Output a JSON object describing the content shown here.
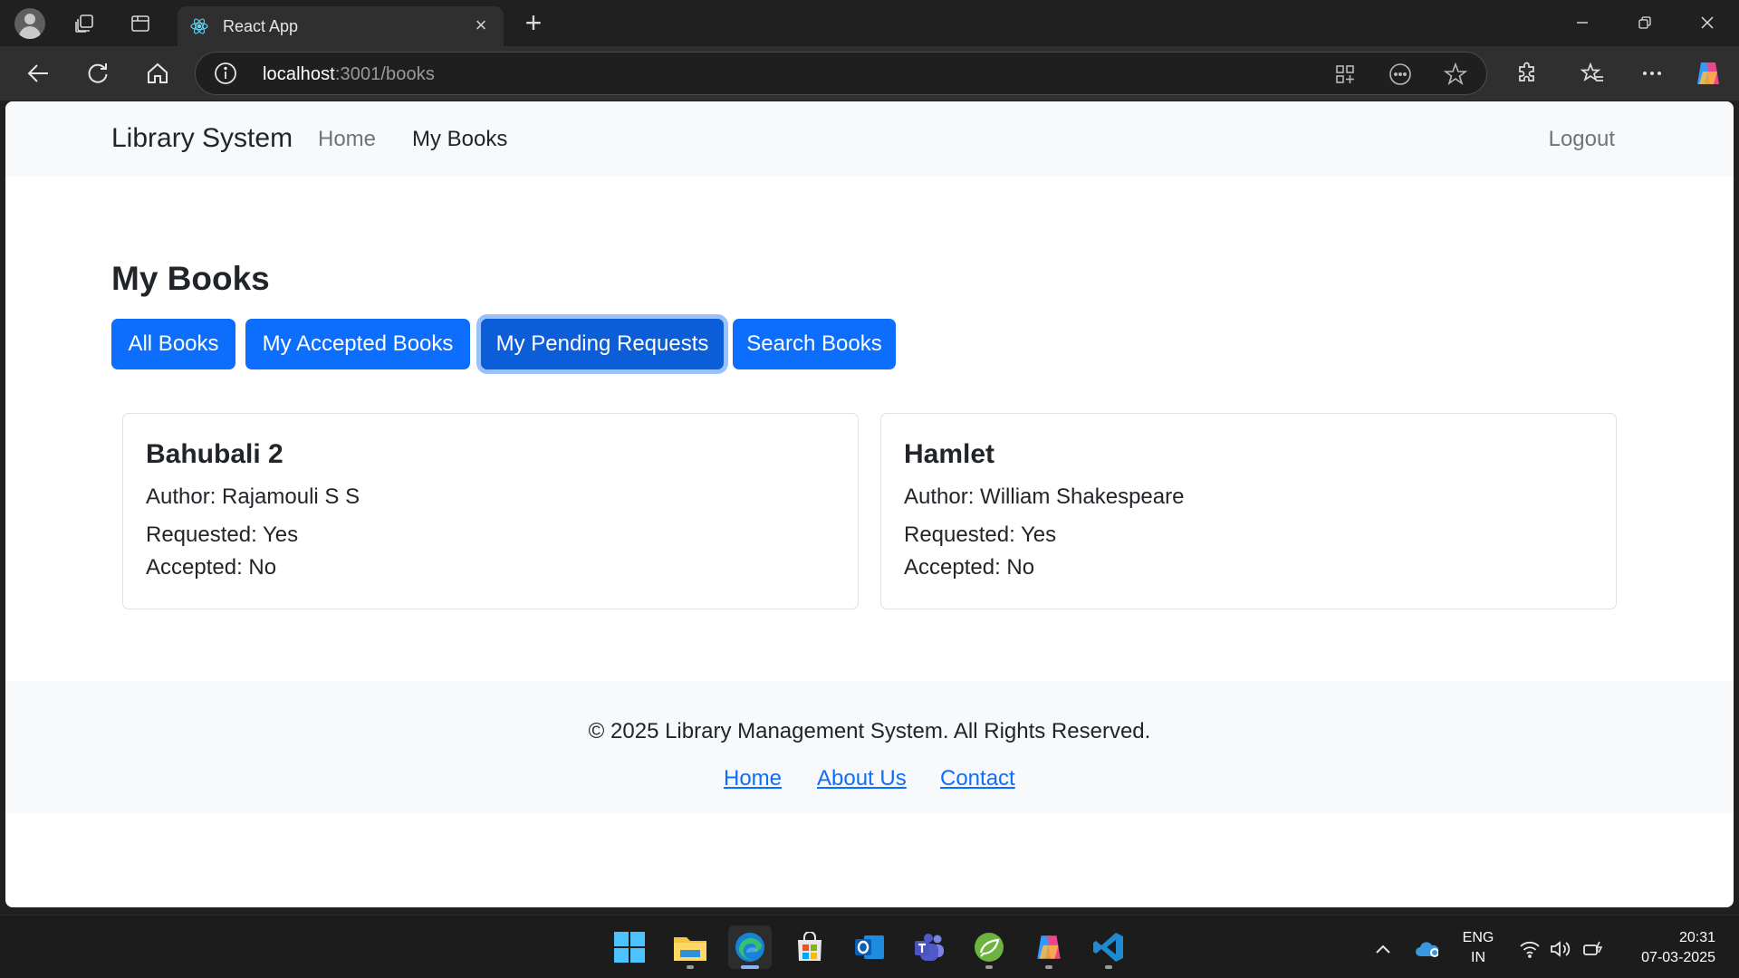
{
  "browser": {
    "tab_title": "React App",
    "url_host": "localhost",
    "url_rest": ":3001/books"
  },
  "navbar": {
    "brand": "Library System",
    "links": [
      "Home",
      "My Books"
    ],
    "logout": "Logout"
  },
  "main": {
    "heading": "My Books",
    "filter_buttons": [
      "All Books",
      "My Accepted Books",
      "My Pending Requests",
      "Search Books"
    ],
    "books": [
      {
        "title": "Bahubali 2",
        "author": "Author: Rajamouli S S",
        "requested": "Requested: Yes",
        "accepted": "Accepted: No"
      },
      {
        "title": "Hamlet",
        "author": "Author: William Shakespeare",
        "requested": "Requested: Yes",
        "accepted": "Accepted: No"
      }
    ]
  },
  "footer": {
    "copyright": "© 2025 Library Management System. All Rights Reserved.",
    "links": [
      "Home",
      "About Us",
      "Contact"
    ]
  },
  "taskbar": {
    "lang_line1": "ENG",
    "lang_line2": "IN",
    "time": "20:31",
    "date": "07-03-2025"
  }
}
